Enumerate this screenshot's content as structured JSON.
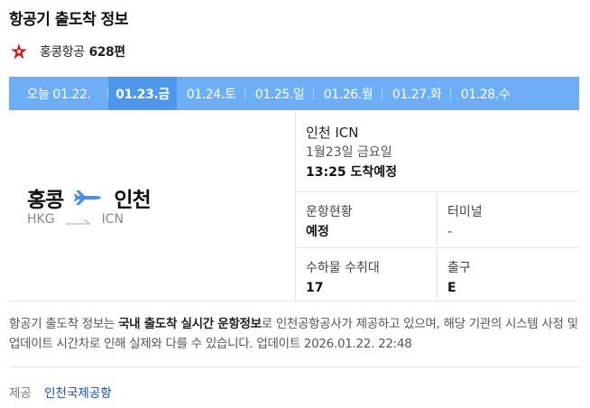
{
  "page_title": "항공기 출도착 정보",
  "airline": {
    "name": "홍콩항공",
    "flight_number": "628편",
    "logo_color": "#d7141a"
  },
  "dates": [
    {
      "label": "오늘 01.22.",
      "active": false
    },
    {
      "label": "01.23.금",
      "active": true
    },
    {
      "label": "01.24.토",
      "active": false
    },
    {
      "label": "01.25.일",
      "active": false
    },
    {
      "label": "01.26.월",
      "active": false
    },
    {
      "label": "01.27.화",
      "active": false
    },
    {
      "label": "01.28.수",
      "active": false
    }
  ],
  "route": {
    "from_city": "홍콩",
    "from_code": "HKG",
    "to_city": "인천",
    "to_code": "ICN",
    "plane_color": "#4a90e2"
  },
  "arrival": {
    "airport": "인천 ICN",
    "date": "1월23일 금요일",
    "time_status": "13:25 도착예정"
  },
  "details": {
    "status_label": "운항현황",
    "status_value": "예정",
    "terminal_label": "터미널",
    "terminal_value": "-",
    "baggage_label": "수하물 수취대",
    "baggage_value": "17",
    "gate_label": "출구",
    "gate_value": "E"
  },
  "notice": {
    "part1": "항공기 출도착 정보는 ",
    "bold": "국내 출도착 실시간 운항정보",
    "part2": "로 인천공항공사가 제공하고 있으며, 해당 기관의 시스템 사정 및 업데이트 시간차로 인해 실제와 다를 수 있습니다. 업데이트 2026.01.22. 22:48"
  },
  "provider": {
    "label": "제공",
    "source": "인천국제공항"
  },
  "colors": {
    "date_bar": "#6eaef4",
    "date_active": "#4f97ea",
    "link": "#1a4fa0"
  }
}
